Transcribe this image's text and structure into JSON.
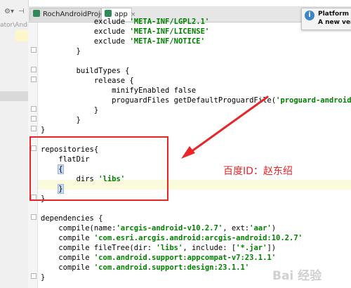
{
  "project_panel": {
    "toolbar_icons": [
      "gear-icon",
      "divider-icon"
    ],
    "path_fragment": "ator\\Andro"
  },
  "tabs": [
    {
      "label": "RochAndroidProject",
      "active": false
    },
    {
      "label": "app",
      "active": true
    }
  ],
  "notification": {
    "title": "Platform ar",
    "subtitle": "A new versi"
  },
  "code_lines": {
    "l0": {
      "pre": "            exclude ",
      "str": "'META-INF/LGPL2.1'"
    },
    "l1": {
      "pre": "            exclude ",
      "str": "'META-INF/LICENSE'"
    },
    "l2": {
      "pre": "            exclude ",
      "str": "'META-INF/NOTICE'"
    },
    "l3": {
      "text": "        }"
    },
    "l4": {
      "text": ""
    },
    "l5": {
      "text": "        buildTypes {"
    },
    "l6": {
      "text": "            release {"
    },
    "l7": {
      "text": "                minifyEnabled false"
    },
    "l8": {
      "pre": "                proguardFiles getDefaultProguardFile(",
      "str": "'proguard-android.txt'"
    },
    "l9": {
      "text": "            }"
    },
    "l10": {
      "text": "        }"
    },
    "l11": {
      "text": "}"
    },
    "l12": {
      "text": ""
    },
    "l13": {
      "text": "repositories{"
    },
    "l14": {
      "text": "    flatDir"
    },
    "l15": {
      "pre": "    ",
      "brace": "{"
    },
    "l16": {
      "pre": "        dirs ",
      "str": "'libs'"
    },
    "l17": {
      "pre": "    ",
      "brace": "}"
    },
    "l18": {
      "text": "}"
    },
    "l19": {
      "text": ""
    },
    "l20": {
      "text": "dependencies {"
    },
    "l21": {
      "pre": "    compile(name:",
      "str": "'arcgis-android-v10.2.7'",
      "mid": ", ext:",
      "str2": "'aar'",
      "post": ")"
    },
    "l22": {
      "pre": "    compile ",
      "str": "'com.esri.arcgis.android:arcgis-android:10.2.7'"
    },
    "l23": {
      "pre": "    compile fileTree(dir: ",
      "str": "'libs'",
      "mid": ", include: [",
      "str2": "'*.jar'",
      "post": "])"
    },
    "l24": {
      "pre": "    compile ",
      "str": "'com.android.support:appcompat-v7:23.1.1'"
    },
    "l25": {
      "pre": "    compile ",
      "str": "'com.android.support:design:23.1.1'"
    },
    "l26": {
      "text": "}"
    }
  },
  "annotation": {
    "label": "百度ID：赵东绍"
  },
  "watermark": {
    "text": "Bai 经验"
  },
  "colors": {
    "annotation_red": "#e8262a",
    "string_green": "#008000",
    "caret_row": "#fcfadc"
  }
}
